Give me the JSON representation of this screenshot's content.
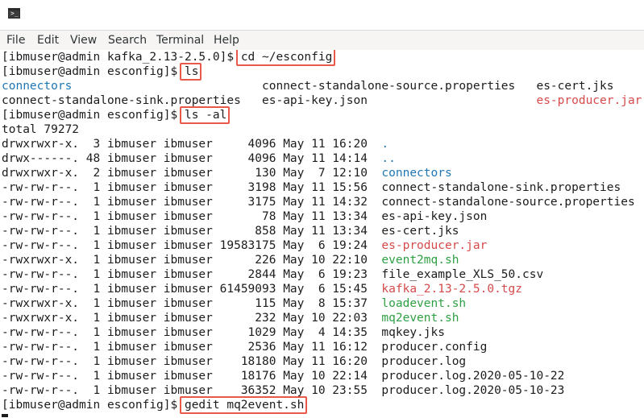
{
  "menu": [
    "File",
    "Edit",
    "View",
    "Search",
    "Terminal",
    "Help"
  ],
  "icons": {
    "window": "terminal-icon"
  },
  "colors": {
    "directory": "#1f77b4",
    "executable": "#2ea043",
    "archive": "#d64a4a",
    "highlight": "#e8594a"
  },
  "lines": [
    {
      "prompt": "[ibmuser@admin kafka_2.13-2.5.0]$ ",
      "cmd": "cd ~/esconfig"
    },
    {
      "prompt": "[ibmuser@admin esconfig]$ ",
      "cmd": "ls"
    },
    {
      "ls": [
        "connectors",
        "connect-standalone-source.properties",
        "es-cert.jks"
      ]
    },
    {
      "ls": [
        "connect-standalone-sink.properties",
        "es-api-key.json",
        "es-producer.jar"
      ]
    },
    {
      "prompt": "[ibmuser@admin esconfig]$ ",
      "cmd": "ls -al"
    },
    {
      "text": "total 79272"
    },
    {
      "entry": [
        "drwxrwxr-x.",
        "3",
        "ibmuser",
        "ibmuser",
        "4096",
        "May",
        "11",
        "16:20",
        "."
      ]
    },
    {
      "entry": [
        "drwx------.",
        "48",
        "ibmuser",
        "ibmuser",
        "4096",
        "May",
        "11",
        "14:14",
        ".."
      ]
    },
    {
      "entry": [
        "drwxrwxr-x.",
        "2",
        "ibmuser",
        "ibmuser",
        "130",
        "May",
        "7",
        "12:10",
        "connectors"
      ]
    },
    {
      "entry": [
        "-rw-rw-r--.",
        "1",
        "ibmuser",
        "ibmuser",
        "3198",
        "May",
        "11",
        "15:56",
        "connect-standalone-sink.properties"
      ]
    },
    {
      "entry": [
        "-rw-rw-r--.",
        "1",
        "ibmuser",
        "ibmuser",
        "3175",
        "May",
        "11",
        "14:32",
        "connect-standalone-source.properties"
      ]
    },
    {
      "entry": [
        "-rw-rw-r--.",
        "1",
        "ibmuser",
        "ibmuser",
        "78",
        "May",
        "11",
        "13:34",
        "es-api-key.json"
      ]
    },
    {
      "entry": [
        "-rw-rw-r--.",
        "1",
        "ibmuser",
        "ibmuser",
        "858",
        "May",
        "11",
        "13:34",
        "es-cert.jks"
      ]
    },
    {
      "entry": [
        "-rw-rw-r--.",
        "1",
        "ibmuser",
        "ibmuser",
        "19583175",
        "May",
        "6",
        "19:24",
        "es-producer.jar"
      ]
    },
    {
      "entry": [
        "-rwxrwxr-x.",
        "1",
        "ibmuser",
        "ibmuser",
        "226",
        "May",
        "10",
        "22:10",
        "event2mq.sh"
      ]
    },
    {
      "entry": [
        "-rw-rw-r--.",
        "1",
        "ibmuser",
        "ibmuser",
        "2844",
        "May",
        "6",
        "19:23",
        "file_example_XLS_50.csv"
      ]
    },
    {
      "entry": [
        "-rw-rw-r--.",
        "1",
        "ibmuser",
        "ibmuser",
        "61459093",
        "May",
        "6",
        "15:45",
        "kafka_2.13-2.5.0.tgz"
      ]
    },
    {
      "entry": [
        "-rwxrwxr-x.",
        "1",
        "ibmuser",
        "ibmuser",
        "115",
        "May",
        "8",
        "15:37",
        "loadevent.sh"
      ]
    },
    {
      "entry": [
        "-rwxrwxr-x.",
        "1",
        "ibmuser",
        "ibmuser",
        "232",
        "May",
        "10",
        "22:03",
        "mq2event.sh"
      ]
    },
    {
      "entry": [
        "-rw-rw-r--.",
        "1",
        "ibmuser",
        "ibmuser",
        "1029",
        "May",
        "4",
        "14:35",
        "mqkey.jks"
      ]
    },
    {
      "entry": [
        "-rw-rw-r--.",
        "1",
        "ibmuser",
        "ibmuser",
        "2536",
        "May",
        "11",
        "16:12",
        "producer.config"
      ]
    },
    {
      "entry": [
        "-rw-rw-r--.",
        "1",
        "ibmuser",
        "ibmuser",
        "18180",
        "May",
        "11",
        "16:20",
        "producer.log"
      ]
    },
    {
      "entry": [
        "-rw-rw-r--.",
        "1",
        "ibmuser",
        "ibmuser",
        "18176",
        "May",
        "10",
        "22:14",
        "producer.log.2020-05-10-22"
      ]
    },
    {
      "entry": [
        "-rw-rw-r--.",
        "1",
        "ibmuser",
        "ibmuser",
        "36352",
        "May",
        "10",
        "23:55",
        "producer.log.2020-05-10-23"
      ]
    },
    {
      "prompt": "[ibmuser@admin esconfig]$ ",
      "cmd": "gedit mq2event.sh"
    }
  ]
}
